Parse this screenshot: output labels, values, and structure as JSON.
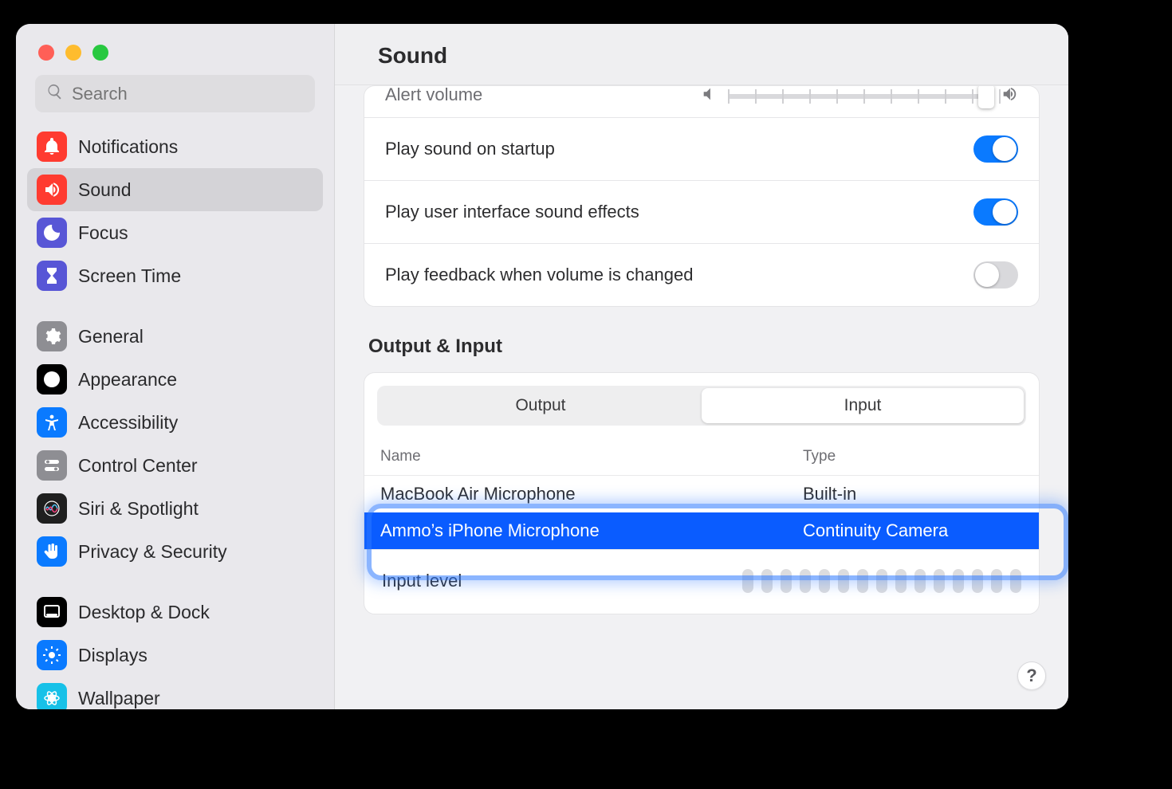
{
  "window": {
    "title": "Sound"
  },
  "search": {
    "placeholder": "Search"
  },
  "sidebar": {
    "items": [
      {
        "label": "Notifications",
        "icon": "bell-icon",
        "color": "#ff3b30"
      },
      {
        "label": "Sound",
        "icon": "speaker-icon",
        "color": "#ff3b30",
        "selected": true
      },
      {
        "label": "Focus",
        "icon": "moon-icon",
        "color": "#5856d6"
      },
      {
        "label": "Screen Time",
        "icon": "hourglass-icon",
        "color": "#5856d6"
      },
      {
        "spacer": true
      },
      {
        "label": "General",
        "icon": "gear-icon",
        "color": "#8e8e93"
      },
      {
        "label": "Appearance",
        "icon": "appearance-icon",
        "color": "#000000"
      },
      {
        "label": "Accessibility",
        "icon": "accessibility-icon",
        "color": "#0a7aff"
      },
      {
        "label": "Control Center",
        "icon": "switches-icon",
        "color": "#8e8e93"
      },
      {
        "label": "Siri & Spotlight",
        "icon": "siri-icon",
        "color": "#1f1f1f"
      },
      {
        "label": "Privacy & Security",
        "icon": "hand-icon",
        "color": "#0a7aff"
      },
      {
        "spacer": true
      },
      {
        "label": "Desktop & Dock",
        "icon": "dock-icon",
        "color": "#000000"
      },
      {
        "label": "Displays",
        "icon": "sun-icon",
        "color": "#0a7aff"
      },
      {
        "label": "Wallpaper",
        "icon": "wallpaper-icon",
        "color": "#17c1e8"
      }
    ]
  },
  "settings": {
    "alert_volume_label": "Alert volume",
    "startup_label": "Play sound on startup",
    "startup_on": true,
    "ui_sounds_label": "Play user interface sound effects",
    "ui_sounds_on": true,
    "feedback_label": "Play feedback when volume is changed",
    "feedback_on": false
  },
  "output_input": {
    "section_title": "Output & Input",
    "tabs": {
      "output": "Output",
      "input": "Input",
      "active": "input"
    },
    "columns": {
      "name": "Name",
      "type": "Type"
    },
    "devices": [
      {
        "name": "MacBook Air Microphone",
        "type": "Built-in",
        "selected": false
      },
      {
        "name": "Ammo’s iPhone Microphone",
        "type": "Continuity Camera",
        "selected": true
      }
    ],
    "input_level_label": "Input level",
    "input_level_bars": 15
  },
  "help": {
    "label": "?"
  }
}
